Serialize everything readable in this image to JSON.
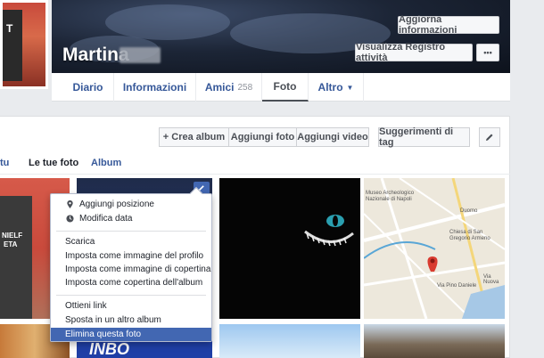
{
  "profile": {
    "name": "Martina",
    "buttons": {
      "update_info": "Aggiorna informazioni",
      "activity_log": "Visualizza Registro attività",
      "more": "•••"
    }
  },
  "nav": {
    "items": [
      {
        "label": "Diario"
      },
      {
        "label": "Informazioni"
      },
      {
        "label": "Amici",
        "count": "258"
      },
      {
        "label": "Foto"
      },
      {
        "label": "Altro",
        "caret": "▼"
      }
    ]
  },
  "photos": {
    "toolbar": {
      "create_album": "+ Crea album",
      "add_photos": "Aggiungi foto",
      "add_video": "Aggiungi video",
      "tag_suggestions": "Suggerimenti di tag",
      "edit_icon": "pencil-icon"
    },
    "subtabs": {
      "partial": "tu",
      "your_photos": "Le tue foto",
      "album": "Album"
    }
  },
  "context_menu": {
    "group1": [
      {
        "label": "Aggiungi posizione",
        "icon": "location-pin-icon"
      },
      {
        "label": "Modifica data",
        "icon": "clock-icon"
      }
    ],
    "group2": [
      {
        "label": "Scarica"
      },
      {
        "label": "Imposta come immagine del profilo"
      },
      {
        "label": "Imposta come immagine di copertina"
      },
      {
        "label": "Imposta come copertina dell'album"
      }
    ],
    "group3": [
      {
        "label": "Ottieni link"
      },
      {
        "label": "Sposta in un altro album"
      },
      {
        "label": "Elimina questa foto",
        "highlighted": true
      }
    ]
  },
  "map": {
    "labels": {
      "museum": "Museo Archeologico Nazionale di Napoli",
      "duomo": "Duomo",
      "church": "Chiesa di San Gregorio Armeno",
      "street": "Via Pino Daniele",
      "via_nuova": "Via Nuova"
    }
  },
  "shirt_text": {
    "line1": "NIELF",
    "line2": "ETA"
  },
  "banner_text": "INBO",
  "colors": {
    "link_blue": "#365899",
    "menu_highlight": "#4267b2",
    "page_bg": "#e9ebee"
  }
}
